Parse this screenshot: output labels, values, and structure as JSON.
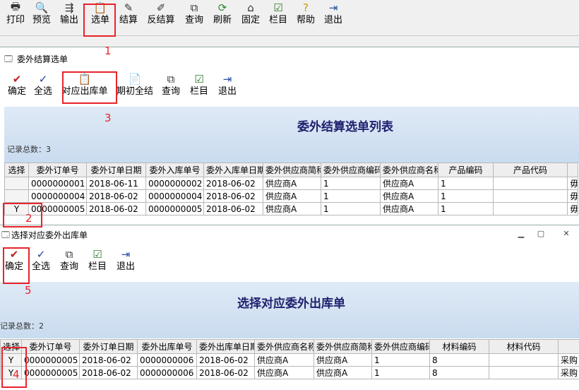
{
  "main_toolbar": [
    {
      "label": "打印",
      "icon": "printer-icon"
    },
    {
      "label": "预览",
      "icon": "preview-icon"
    },
    {
      "label": "输出",
      "icon": "export-icon"
    },
    {
      "label": "选单",
      "icon": "select-document-icon"
    },
    {
      "label": "结算",
      "icon": "settle-icon"
    },
    {
      "label": "反结算",
      "icon": "unsettle-icon"
    },
    {
      "label": "查询",
      "icon": "binoculars-icon"
    },
    {
      "label": "刷新",
      "icon": "refresh-icon"
    },
    {
      "label": "固定",
      "icon": "pin-icon"
    },
    {
      "label": "栏目",
      "icon": "columns-icon"
    },
    {
      "label": "帮助",
      "icon": "help-icon"
    },
    {
      "label": "退出",
      "icon": "exit-icon"
    }
  ],
  "window1": {
    "title": "委外结算选单",
    "toolbar": [
      {
        "label": "确定",
        "icon": "confirm-icon"
      },
      {
        "label": "全选",
        "icon": "select-all-icon"
      },
      {
        "label": "对应出库单",
        "icon": "outbound-document-icon"
      },
      {
        "label": "期初全结",
        "icon": "opening-settle-icon"
      },
      {
        "label": "查询",
        "icon": "binoculars-icon"
      },
      {
        "label": "栏目",
        "icon": "columns-icon"
      },
      {
        "label": "退出",
        "icon": "exit-icon"
      }
    ],
    "list_title": "委外结算选单列表",
    "record_count": "记录总数：3",
    "columns": [
      "选择",
      "委外订单号",
      "委外订单日期",
      "委外入库单号",
      "委外入库单日期",
      "委外供应商简称",
      "委外供应商编码",
      "委外供应商名称",
      "产品编码",
      "产品代码",
      ""
    ],
    "rows": [
      [
        "",
        "0000000001",
        "2018-06-11",
        "0000000002",
        "2018-06-02",
        "供应商A",
        "1",
        "供应商A",
        "1",
        "",
        "毋"
      ],
      [
        "",
        "0000000004",
        "2018-06-02",
        "0000000004",
        "2018-06-02",
        "供应商A",
        "1",
        "供应商A",
        "1",
        "",
        "毋"
      ],
      [
        "Y",
        "0000000005",
        "2018-06-02",
        "0000000005",
        "2018-06-02",
        "供应商A",
        "1",
        "供应商A",
        "1",
        "",
        "毋"
      ]
    ]
  },
  "window2": {
    "title": "选择对应委外出库单",
    "toolbar": [
      {
        "label": "确定",
        "icon": "confirm-icon"
      },
      {
        "label": "全选",
        "icon": "select-all-icon"
      },
      {
        "label": "查询",
        "icon": "binoculars-icon"
      },
      {
        "label": "栏目",
        "icon": "columns-icon"
      },
      {
        "label": "退出",
        "icon": "exit-icon"
      }
    ],
    "list_title": "选择对应委外出库单",
    "record_count": "记录总数：2",
    "columns": [
      "选择",
      "委外订单号",
      "委外订单日期",
      "委外出库单号",
      "委外出库单日期",
      "委外供应商名称",
      "委外供应商简称",
      "委外供应商编码",
      "材料编码",
      "材料代码",
      ""
    ],
    "rows": [
      [
        "Y",
        "0000000005",
        "2018-06-02",
        "0000000006",
        "2018-06-02",
        "供应商A",
        "供应商A",
        "1",
        "8",
        "",
        "采购"
      ],
      [
        "Y",
        "0000000005",
        "2018-06-02",
        "0000000006",
        "2018-06-02",
        "供应商A",
        "供应商A",
        "1",
        "8",
        "",
        "采购"
      ]
    ]
  },
  "annotations": [
    "1",
    "2",
    "3",
    "4",
    "5"
  ],
  "colors": {
    "annotation_red": "#e8232a",
    "list_title": "#1f1f6e"
  }
}
